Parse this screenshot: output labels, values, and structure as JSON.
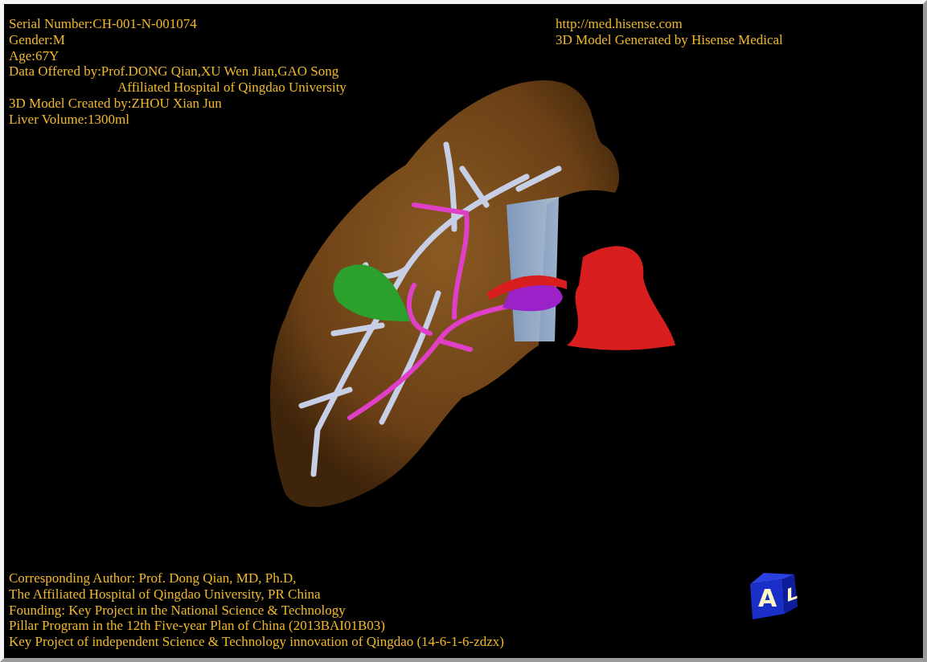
{
  "info_lines": [
    {
      "kind": "line",
      "text": "Serial Number:CH-001-N-001074"
    },
    {
      "kind": "line",
      "text": "Gender:M"
    },
    {
      "kind": "line",
      "text": "Age:67Y"
    },
    {
      "kind": "line",
      "text": "Data Offered by:Prof.DONG Qian,XU Wen Jian,GAO Song"
    },
    {
      "kind": "continuation",
      "text": "Affiliated Hospital of Qingdao University"
    },
    {
      "kind": "line",
      "text": "3D Model Created by:ZHOU Xian Jun"
    },
    {
      "kind": "line",
      "text": "Liver Volume:1300ml"
    }
  ],
  "credit_lines": [
    "http://med.hisense.com",
    "3D Model Generated by Hisense Medical"
  ],
  "orientation_cube": {
    "front_label": "A",
    "side_label": "L"
  },
  "footer_lines": [
    "Corresponding Author: Prof. Dong Qian, MD, Ph.D,",
    "The Affiliated Hospital of Qingdao University, PR China",
    "Founding: Key Project in the National Science & Technology",
    "Pillar Program in the 12th Five-year Plan of China (2013BAI01B03)",
    "Key Project of independent Science & Technology innovation of Qingdao (14-6-1-6-zdzx)"
  ]
}
